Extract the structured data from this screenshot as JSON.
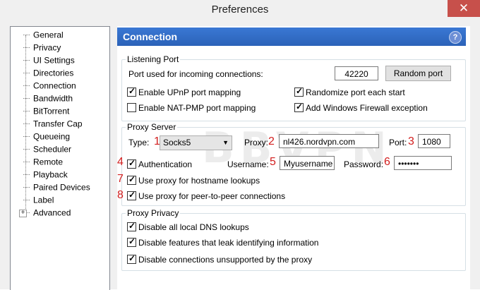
{
  "window": {
    "title": "Preferences",
    "close_glyph": "✕"
  },
  "sidebar": {
    "items": [
      {
        "label": "General"
      },
      {
        "label": "Privacy"
      },
      {
        "label": "UI Settings"
      },
      {
        "label": "Directories"
      },
      {
        "label": "Connection"
      },
      {
        "label": "Bandwidth"
      },
      {
        "label": "BitTorrent"
      },
      {
        "label": "Transfer Cap"
      },
      {
        "label": "Queueing"
      },
      {
        "label": "Scheduler"
      },
      {
        "label": "Remote"
      },
      {
        "label": "Playback"
      },
      {
        "label": "Paired Devices"
      },
      {
        "label": "Label"
      },
      {
        "label": "Advanced"
      }
    ],
    "expander_glyph": "+"
  },
  "header": {
    "title": "Connection",
    "help_label": "?"
  },
  "listening_port": {
    "legend": "Listening Port",
    "port_label": "Port used for incoming connections:",
    "port_value": "42220",
    "random_port_label": "Random port",
    "upnp_label": "Enable UPnP port mapping",
    "upnp_checked": true,
    "natpmp_label": "Enable NAT-PMP port mapping",
    "natpmp_checked": false,
    "randomize_label": "Randomize port each start",
    "randomize_checked": true,
    "firewall_label": "Add Windows Firewall exception",
    "firewall_checked": true
  },
  "proxy_server": {
    "legend": "Proxy Server",
    "type_label": "Type:",
    "type_value": "Socks5",
    "proxy_label": "Proxy:",
    "proxy_value": "nl426.nordvpn.com",
    "port_label": "Port:",
    "port_value": "1080",
    "auth_label": "Authentication",
    "auth_checked": true,
    "username_label": "Username:",
    "username_value": "Myusername",
    "password_label": "Password:",
    "password_value": "•••••••",
    "hostname_label": "Use proxy for hostname lookups",
    "hostname_checked": true,
    "p2p_label": "Use proxy for peer-to-peer connections",
    "p2p_checked": true
  },
  "proxy_privacy": {
    "legend": "Proxy Privacy",
    "dns_label": "Disable all local DNS lookups",
    "dns_checked": true,
    "leak_label": "Disable features that leak identifying information",
    "leak_checked": true,
    "unsupported_label": "Disable connections unsupported by the proxy",
    "unsupported_checked": true
  },
  "annotations": [
    "1",
    "2",
    "3",
    "4",
    "5",
    "6",
    "7",
    "8"
  ],
  "watermark": "BBVPN",
  "check_glyph": "✓",
  "dropdown_glyph": "▼",
  "colors": {
    "header": "#2b62b8",
    "annotation": "#d21e1e",
    "close": "#c7504b"
  }
}
